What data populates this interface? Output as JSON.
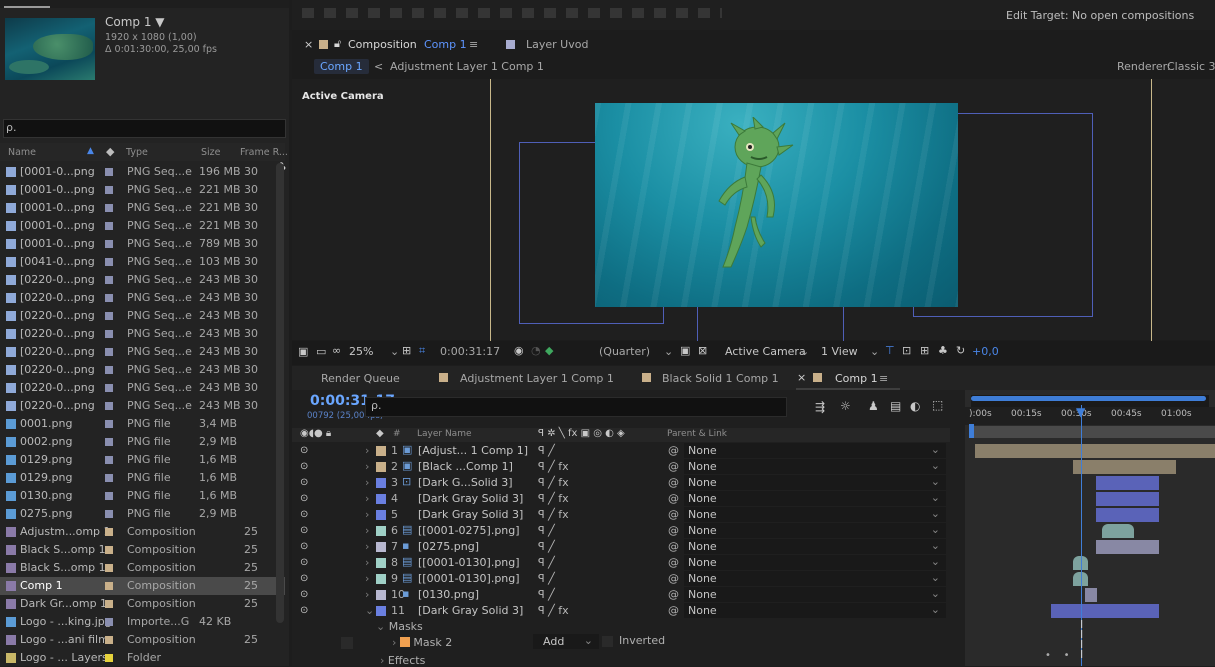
{
  "project": {
    "comp_title": "Comp 1 ▼",
    "comp_res": "1920 x 1080 (1,00)",
    "comp_dur": "Δ 0:01:30:00, 25,00 fps",
    "search_placeholder": "ρ.",
    "cols": {
      "name": "Name",
      "type": "Type",
      "size": "Size",
      "frame": "Frame R..."
    },
    "items": [
      {
        "name": "[0001-0...png",
        "type": "PNG Seq...e",
        "size": "196 MB",
        "frame": "30",
        "icon": "sequence",
        "label": "#8a8fb0"
      },
      {
        "name": "[0001-0...png",
        "type": "PNG Seq...e",
        "size": "221 MB",
        "frame": "30",
        "icon": "sequence",
        "label": "#8a8fb0"
      },
      {
        "name": "[0001-0...png",
        "type": "PNG Seq...e",
        "size": "221 MB",
        "frame": "30",
        "icon": "sequence",
        "label": "#8a8fb0"
      },
      {
        "name": "[0001-0...png",
        "type": "PNG Seq...e",
        "size": "221 MB",
        "frame": "30",
        "icon": "sequence",
        "label": "#8a8fb0"
      },
      {
        "name": "[0001-0...png",
        "type": "PNG Seq...e",
        "size": "789 MB",
        "frame": "30",
        "icon": "sequence",
        "label": "#8a8fb0"
      },
      {
        "name": "[0041-0...png",
        "type": "PNG Seq...e",
        "size": "103 MB",
        "frame": "30",
        "icon": "sequence",
        "label": "#8a8fb0"
      },
      {
        "name": "[0220-0...png",
        "type": "PNG Seq...e",
        "size": "243 MB",
        "frame": "30",
        "icon": "sequence",
        "label": "#8a8fb0"
      },
      {
        "name": "[0220-0...png",
        "type": "PNG Seq...e",
        "size": "243 MB",
        "frame": "30",
        "icon": "sequence",
        "label": "#8a8fb0"
      },
      {
        "name": "[0220-0...png",
        "type": "PNG Seq...e",
        "size": "243 MB",
        "frame": "30",
        "icon": "sequence",
        "label": "#8a8fb0"
      },
      {
        "name": "[0220-0...png",
        "type": "PNG Seq...e",
        "size": "243 MB",
        "frame": "30",
        "icon": "sequence",
        "label": "#8a8fb0"
      },
      {
        "name": "[0220-0...png",
        "type": "PNG Seq...e",
        "size": "243 MB",
        "frame": "30",
        "icon": "sequence",
        "label": "#8a8fb0"
      },
      {
        "name": "[0220-0...png",
        "type": "PNG Seq...e",
        "size": "243 MB",
        "frame": "30",
        "icon": "sequence",
        "label": "#8a8fb0"
      },
      {
        "name": "[0220-0...png",
        "type": "PNG Seq...e",
        "size": "243 MB",
        "frame": "30",
        "icon": "sequence",
        "label": "#8a8fb0"
      },
      {
        "name": "[0220-0...png",
        "type": "PNG Seq...e",
        "size": "243 MB",
        "frame": "30",
        "icon": "sequence",
        "label": "#8a8fb0"
      },
      {
        "name": "0001.png",
        "type": "PNG file",
        "size": "3,4 MB",
        "frame": "",
        "icon": "image",
        "label": "#8a8fb0"
      },
      {
        "name": "0002.png",
        "type": "PNG file",
        "size": "2,9 MB",
        "frame": "",
        "icon": "image",
        "label": "#8a8fb0"
      },
      {
        "name": "0129.png",
        "type": "PNG file",
        "size": "1,6 MB",
        "frame": "",
        "icon": "image",
        "label": "#8a8fb0"
      },
      {
        "name": "0129.png",
        "type": "PNG file",
        "size": "1,6 MB",
        "frame": "",
        "icon": "image",
        "label": "#8a8fb0"
      },
      {
        "name": "0130.png",
        "type": "PNG file",
        "size": "1,6 MB",
        "frame": "",
        "icon": "image",
        "label": "#8a8fb0"
      },
      {
        "name": "0275.png",
        "type": "PNG file",
        "size": "2,9 MB",
        "frame": "",
        "icon": "image",
        "label": "#8a8fb0"
      },
      {
        "name": "Adjustm...omp 1",
        "type": "Composition",
        "size": "",
        "frame": "25",
        "icon": "comp",
        "label": "#c9b08a"
      },
      {
        "name": "Black S...omp 1",
        "type": "Composition",
        "size": "",
        "frame": "25",
        "icon": "comp",
        "label": "#c9b08a"
      },
      {
        "name": "Black S...omp 1",
        "type": "Composition",
        "size": "",
        "frame": "25",
        "icon": "comp",
        "label": "#c9b08a"
      },
      {
        "name": "Comp 1",
        "type": "Composition",
        "size": "",
        "frame": "25",
        "icon": "comp",
        "label": "#c9b08a",
        "selected": true
      },
      {
        "name": "Dark Gr...omp 1",
        "type": "Composition",
        "size": "",
        "frame": "25",
        "icon": "comp",
        "label": "#c9b08a"
      },
      {
        "name": "Logo - ...king.jpg",
        "type": "Importe...G",
        "size": "42 KB",
        "frame": "",
        "icon": "image",
        "label": "#8a8fb0"
      },
      {
        "name": "Logo - ...ani film",
        "type": "Composition",
        "size": "",
        "frame": "25",
        "icon": "comp",
        "label": "#c9b08a"
      },
      {
        "name": "Logo - ... Layers",
        "type": "Folder",
        "size": "",
        "frame": "",
        "icon": "folder",
        "label": "#e6d23c"
      }
    ]
  },
  "top": {
    "edit_target": "Edit Target: No open compositions"
  },
  "viewer": {
    "tab_close": "×",
    "tab_label": "Composition",
    "tab_comp": "Comp 1",
    "tab_menu": "≡",
    "layer_tab": "Layer Uvod",
    "breadcrumb_1": "Comp 1",
    "breadcrumb_sep": "<",
    "breadcrumb_2": "Adjustment Layer 1 Comp 1",
    "renderer_label": "Renderer:",
    "renderer_value": "Classic 3",
    "active_camera": "Active Camera",
    "zoom": "25%",
    "time": "0:00:31:17",
    "resolution": "(Quarter)",
    "camera": "Active Camera",
    "views": "1 View",
    "exposure": "+0,0"
  },
  "timeline_tabs": {
    "render_queue": "Render Queue",
    "tab1": "Adjustment Layer 1 Comp 1",
    "tab2": "Black Solid 1 Comp 1",
    "tab3_close": "×",
    "tab3": "Comp 1",
    "tab3_menu": "≡"
  },
  "timeline": {
    "timecode": "0:00:31:17",
    "frames": "00792 (25,00 fps)",
    "search": "ρ.",
    "hdr_layer": "Layer Name",
    "hdr_num": "#",
    "hdr_parent": "Parent & Link",
    "ticks": [
      "):00s",
      "00:15s",
      "00:30s",
      "00:45s",
      "01:00s"
    ],
    "layers": [
      {
        "num": "1",
        "name": "[Adjust... 1 Comp 1]",
        "sw": "ꟼ  ╱",
        "parent": "None",
        "color": "#c9b08a",
        "icon": "comp"
      },
      {
        "num": "2",
        "name": "[Black ...Comp 1]",
        "sw": "ꟼ  ╱ fx",
        "parent": "None",
        "color": "#c9b08a",
        "icon": "comp"
      },
      {
        "num": "3",
        "name": "[Dark G...Solid 3]",
        "sw": "ꟼ  ╱ fx",
        "parent": "None",
        "color": "#6a7fe0",
        "icon": "solid"
      },
      {
        "num": "4",
        "name": "[Dark Gray Solid 3]",
        "sw": "ꟼ  ╱ fx",
        "parent": "None",
        "color": "#6a7fe0",
        "icon": "none"
      },
      {
        "num": "5",
        "name": "[Dark Gray Solid 3]",
        "sw": "ꟼ  ╱ fx",
        "parent": "None",
        "color": "#6a7fe0",
        "icon": "none"
      },
      {
        "num": "6",
        "name": "[[0001-0275].png]",
        "sw": "ꟼ  ╱",
        "parent": "None",
        "color": "#9fd0c6",
        "icon": "sequence"
      },
      {
        "num": "7",
        "name": "[0275.png]",
        "sw": "ꟼ  ╱",
        "parent": "None",
        "color": "#b8b8d0",
        "icon": "image"
      },
      {
        "num": "8",
        "name": "[[0001-0130].png]",
        "sw": "ꟼ  ╱",
        "parent": "None",
        "color": "#9fd0c6",
        "icon": "sequence"
      },
      {
        "num": "9",
        "name": "[[0001-0130].png]",
        "sw": "ꟼ  ╱",
        "parent": "None",
        "color": "#9fd0c6",
        "icon": "sequence"
      },
      {
        "num": "10",
        "name": "[0130.png]",
        "sw": "ꟼ  ╱",
        "parent": "None",
        "color": "#b8b8d0",
        "icon": "image"
      },
      {
        "num": "11",
        "name": "[Dark Gray Solid 3]",
        "sw": "ꟼ  ╱ fx",
        "parent": "None",
        "color": "#6a7fe0",
        "icon": "none"
      }
    ],
    "masks": "Masks",
    "mask2": "Mask 2",
    "mask_mode": "Add",
    "inverted": "Inverted",
    "effects": "Effects"
  }
}
